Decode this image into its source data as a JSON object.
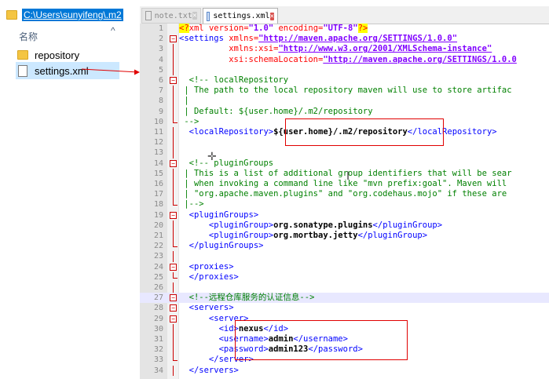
{
  "explorer": {
    "address": "C:\\Users\\sunyifeng\\.m2",
    "column_header": "名称",
    "column_chevron": "^",
    "items": [
      {
        "label": "repository",
        "icon": "folder-icon"
      },
      {
        "label": "settings.xml",
        "icon": "file-icon"
      }
    ]
  },
  "editor": {
    "tabs": [
      {
        "label": "note.txt",
        "active": false
      },
      {
        "label": "settings.xml",
        "active": true
      }
    ],
    "tab_close_glyph": "✕",
    "cursor_glyph": "I",
    "crosshair_glyph": "✛",
    "lines": [
      {
        "n": "1",
        "tokens": [
          [
            "t-pi",
            "<?"
          ],
          [
            "t-red",
            "xml "
          ],
          [
            "t-red",
            "version="
          ],
          [
            "t-purple",
            "\"1.0\""
          ],
          [
            "t-red",
            " encoding="
          ],
          [
            "t-purple",
            "\"UTF-8\""
          ],
          [
            "t-pi",
            "?>"
          ]
        ]
      },
      {
        "n": "2",
        "tokens": [
          [
            "t-blue",
            "<settings "
          ],
          [
            "t-red",
            "xmlns="
          ],
          [
            "t-url",
            "\"http://maven.apache.org/SETTINGS/1.0.0\""
          ]
        ]
      },
      {
        "n": "3",
        "tokens": [
          [
            "t-red",
            "          xmlns:xsi="
          ],
          [
            "t-url",
            "\"http://www.w3.org/2001/XMLSchema-instance\""
          ]
        ]
      },
      {
        "n": "4",
        "tokens": [
          [
            "t-red",
            "          xsi:schemaLocation="
          ],
          [
            "t-url",
            "\"http://maven.apache.org/SETTINGS/1.0.0"
          ]
        ]
      },
      {
        "n": "5",
        "tokens": []
      },
      {
        "n": "6",
        "tokens": [
          [
            "t-green",
            "  <!-- localRepository"
          ]
        ]
      },
      {
        "n": "7",
        "tokens": [
          [
            "t-green",
            " | The path to the local repository maven will use to store artifac"
          ]
        ]
      },
      {
        "n": "8",
        "tokens": [
          [
            "t-green",
            " |"
          ]
        ]
      },
      {
        "n": "9",
        "tokens": [
          [
            "t-green",
            " | Default: ${user.home}/.m2/repository"
          ]
        ]
      },
      {
        "n": "10",
        "tokens": [
          [
            "t-green",
            " -->"
          ]
        ]
      },
      {
        "n": "11",
        "tokens": [
          [
            "t-blue",
            "  <localRepository>"
          ],
          [
            "t-black-b",
            "${user.home}/.m2/repository"
          ],
          [
            "t-blue",
            "</localRepository>"
          ]
        ]
      },
      {
        "n": "12",
        "tokens": []
      },
      {
        "n": "13",
        "tokens": []
      },
      {
        "n": "14",
        "tokens": [
          [
            "t-green",
            "  <!-- pluginGroups"
          ]
        ]
      },
      {
        "n": "15",
        "tokens": [
          [
            "t-green",
            " | This is a list of additional group identifiers that will be sear"
          ]
        ]
      },
      {
        "n": "16",
        "tokens": [
          [
            "t-green",
            " | when invoking a command line like \"mvn prefix:goal\". Maven will"
          ]
        ]
      },
      {
        "n": "17",
        "tokens": [
          [
            "t-green",
            " | \"org.apache.maven.plugins\" and \"org.codehaus.mojo\" if these are"
          ]
        ]
      },
      {
        "n": "18",
        "tokens": [
          [
            "t-green",
            " |-->"
          ]
        ]
      },
      {
        "n": "19",
        "tokens": [
          [
            "t-blue",
            "  <pluginGroups>"
          ]
        ]
      },
      {
        "n": "20",
        "tokens": [
          [
            "t-blue",
            "      <pluginGroup>"
          ],
          [
            "t-black-b",
            "org.sonatype.plugins"
          ],
          [
            "t-blue",
            "</pluginGroup>"
          ]
        ]
      },
      {
        "n": "21",
        "tokens": [
          [
            "t-blue",
            "      <pluginGroup>"
          ],
          [
            "t-black-b",
            "org.mortbay.jetty"
          ],
          [
            "t-blue",
            "</pluginGroup>"
          ]
        ]
      },
      {
        "n": "22",
        "tokens": [
          [
            "t-blue",
            "  </pluginGroups>"
          ]
        ]
      },
      {
        "n": "23",
        "tokens": []
      },
      {
        "n": "24",
        "tokens": [
          [
            "t-blue",
            "  <proxies>"
          ]
        ]
      },
      {
        "n": "25",
        "tokens": [
          [
            "t-blue",
            "  </proxies>"
          ]
        ]
      },
      {
        "n": "26",
        "tokens": []
      },
      {
        "n": "27",
        "tokens": [
          [
            "t-green",
            "  <!--远程仓库服务的认证信息-->"
          ]
        ]
      },
      {
        "n": "28",
        "tokens": [
          [
            "t-blue",
            "  <servers>"
          ]
        ]
      },
      {
        "n": "29",
        "tokens": [
          [
            "t-blue",
            "      <server>"
          ]
        ]
      },
      {
        "n": "30",
        "tokens": [
          [
            "t-blue",
            "        <id>"
          ],
          [
            "t-black-b",
            "nexus"
          ],
          [
            "t-blue",
            "</id>"
          ]
        ]
      },
      {
        "n": "31",
        "tokens": [
          [
            "t-blue",
            "        <username>"
          ],
          [
            "t-black-b",
            "admin"
          ],
          [
            "t-blue",
            "</username>"
          ]
        ]
      },
      {
        "n": "32",
        "tokens": [
          [
            "t-blue",
            "        <password>"
          ],
          [
            "t-black-b",
            "admin123"
          ],
          [
            "t-blue",
            "</password>"
          ]
        ]
      },
      {
        "n": "33",
        "tokens": [
          [
            "t-blue",
            "      </server>"
          ]
        ]
      },
      {
        "n": "34",
        "tokens": [
          [
            "t-blue",
            "  </servers>"
          ]
        ]
      }
    ]
  }
}
